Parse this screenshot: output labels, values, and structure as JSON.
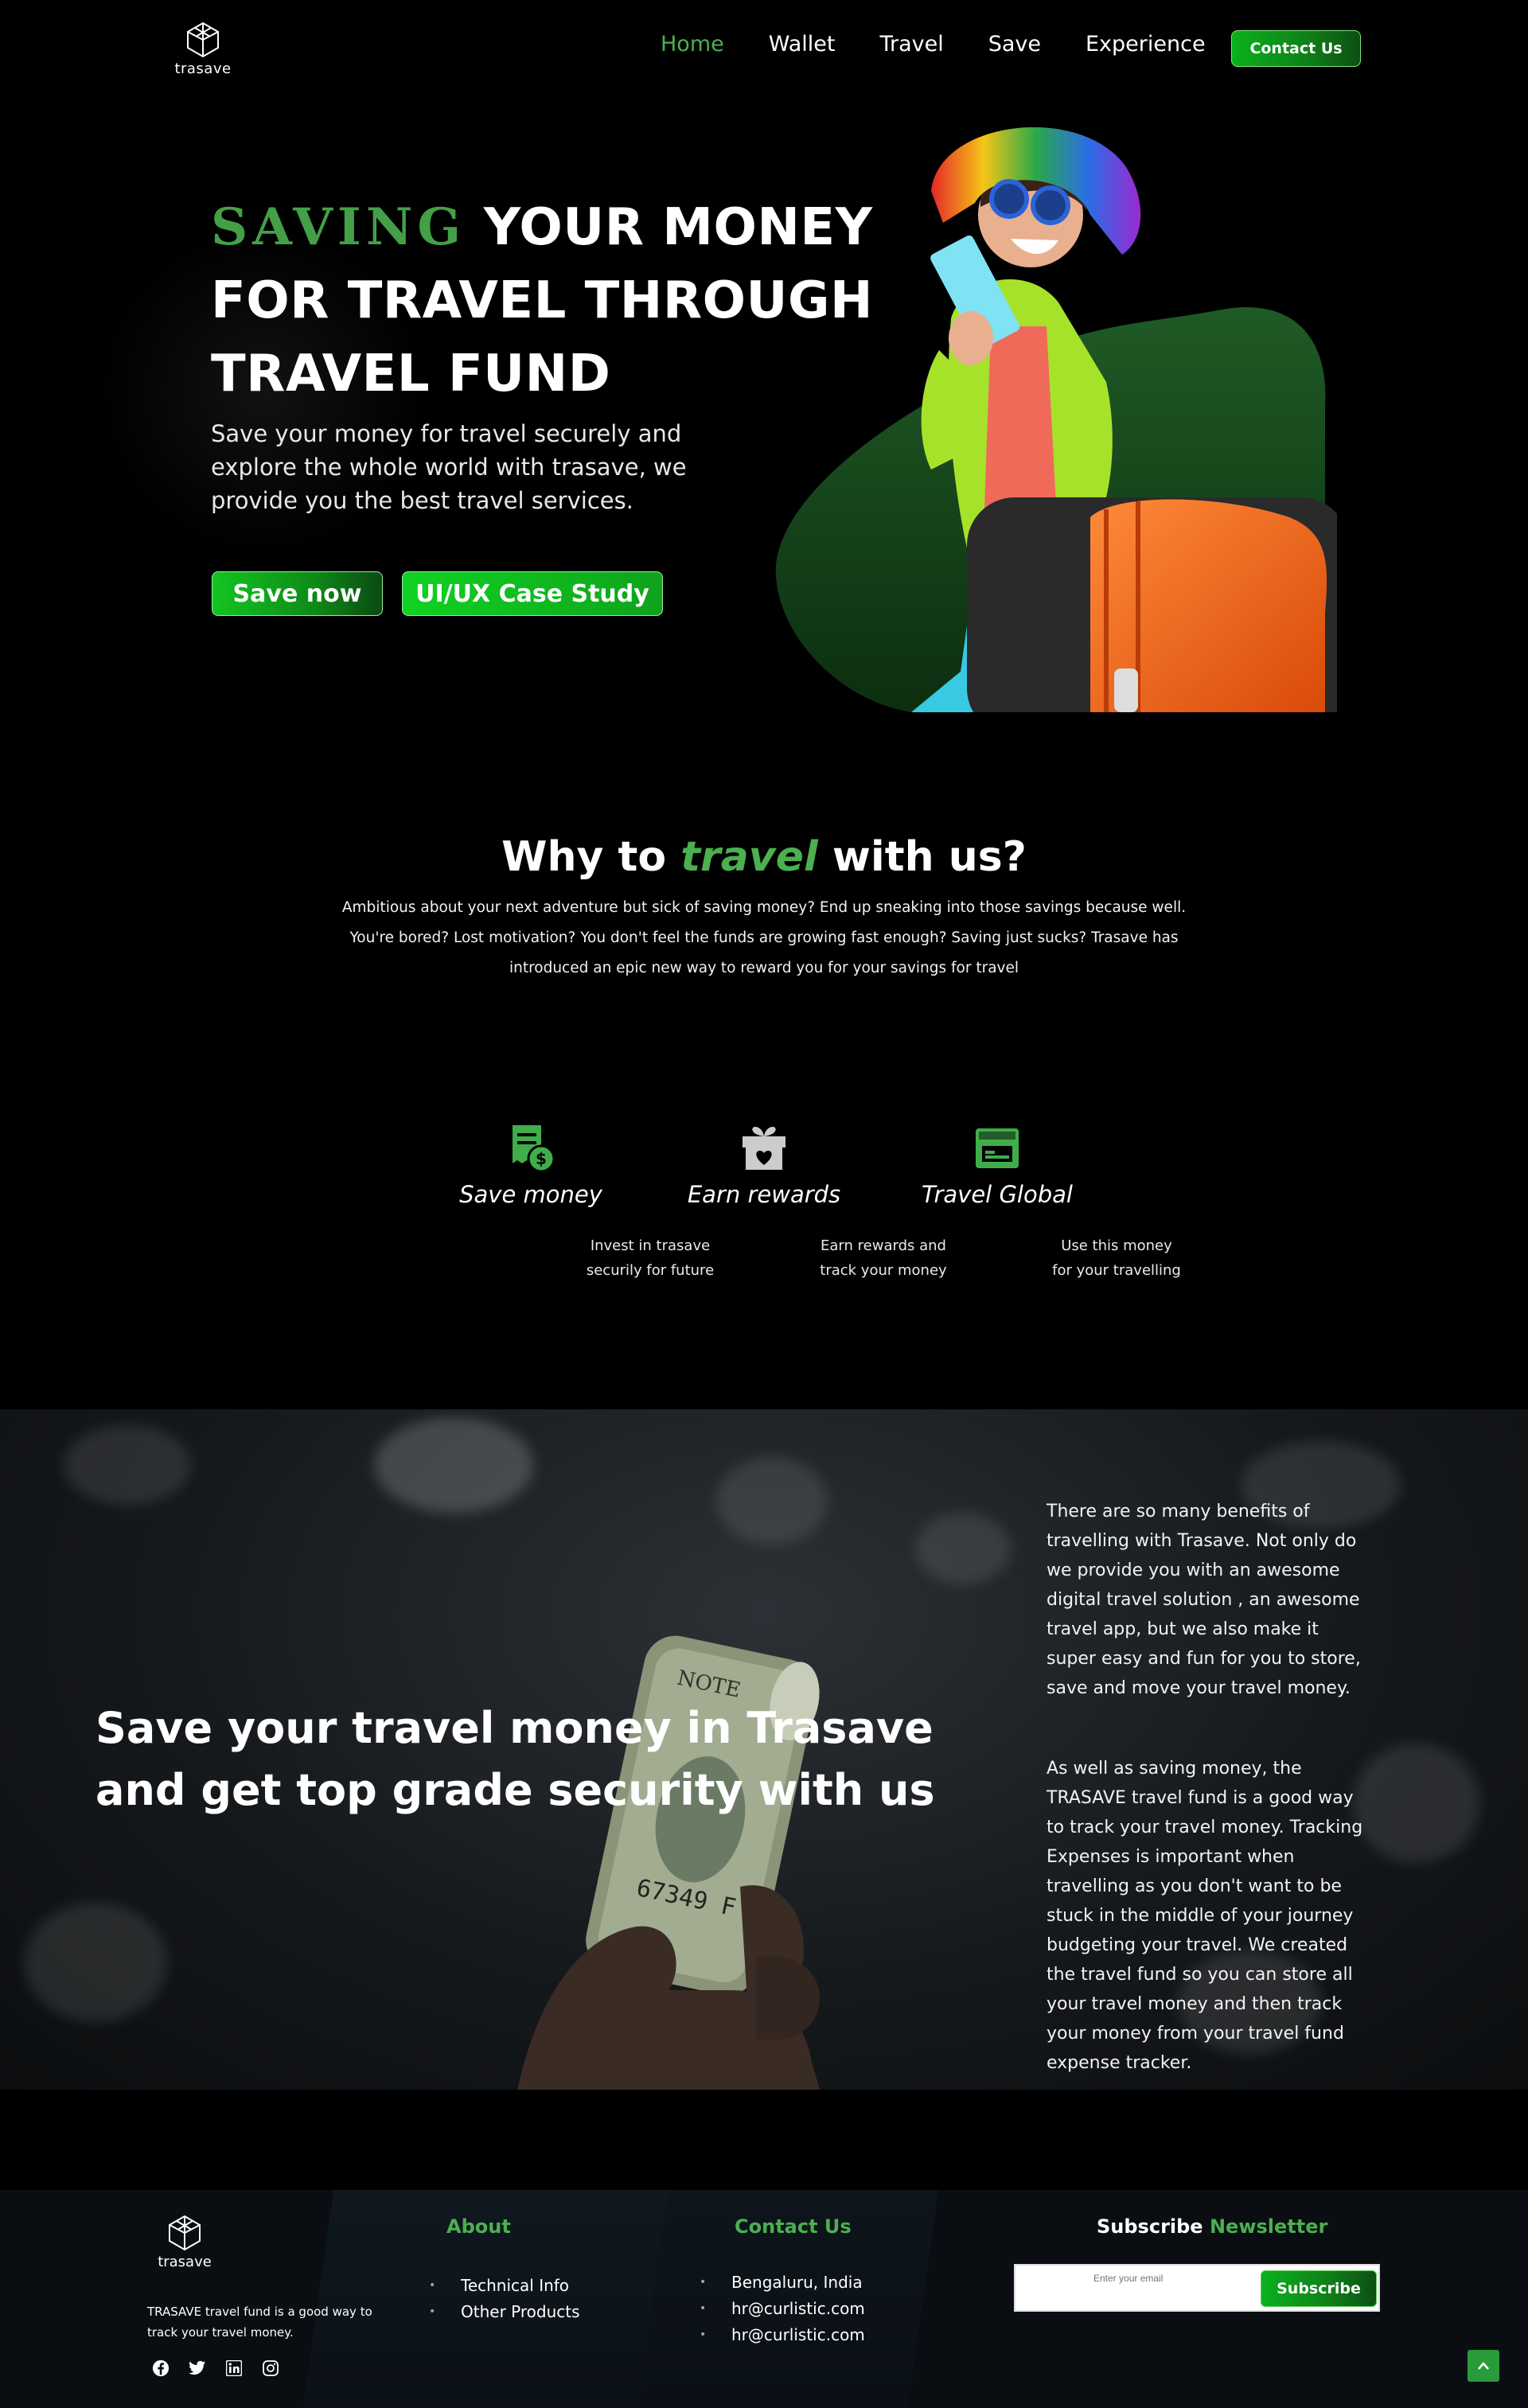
{
  "brand": {
    "name": "trasave"
  },
  "nav": {
    "items": [
      {
        "label": "Home",
        "active": true
      },
      {
        "label": "Wallet"
      },
      {
        "label": "Travel"
      },
      {
        "label": "Save"
      },
      {
        "label": "Experience"
      }
    ],
    "contact_label": "Contact Us"
  },
  "hero": {
    "title_accent": "SAVING",
    "title_rest": " YOUR MONEY FOR TRAVEL THROUGH TRAVEL FUND",
    "subtitle": "Save your money for travel securely and explore the whole world with trasave, we provide you the best travel services.",
    "btn_primary": "Save now",
    "btn_secondary": "UI/UX Case Study"
  },
  "why": {
    "title_before": "Why to ",
    "title_accent": "travel",
    "title_after": " with us?",
    "text": "Ambitious about your next adventure but sick of saving money? End up sneaking into those savings because well. You're bored? Lost motivation? You don't feel the funds are growing fast enough? Saving just sucks? Trasave has introduced an epic new way to reward you for your savings for travel"
  },
  "features": [
    {
      "icon": "receipt-dollar-icon",
      "title": "Save money",
      "desc": "Invest in trasave securily for future"
    },
    {
      "icon": "gift-heart-icon",
      "title": "Earn rewards",
      "desc": "Earn rewards and track your money"
    },
    {
      "icon": "store-icon",
      "title": "Travel Global",
      "desc": "Use this money for your travelling"
    }
  ],
  "security": {
    "title": "Save your travel money in Trasave and get top grade security with us",
    "p1": "There are so many benefits of travelling with Trasave. Not only do we provide you with an awesome digital travel solution , an awesome travel app, but we also make it super easy and fun for you to store, save and move your travel money.",
    "p2": "As well as saving money, the TRASAVE travel fund is a good way to track your travel money. Tracking Expenses is important when travelling as you don't want to be stuck in the middle of your journey budgeting your travel. We created the travel fund so you can store all your travel money and then track your money from your travel fund expense tracker."
  },
  "footer": {
    "description": "TRASAVE travel fund is a good way to track your travel money.",
    "about_heading": "About",
    "about_items": [
      "Technical Info",
      "Other Products"
    ],
    "contact_heading": "Contact Us",
    "contact_items": [
      "Bengaluru, India",
      "hr@curlistic.com",
      "hr@curlistic.com"
    ],
    "newsletter_heading_1": "Subscribe",
    "newsletter_heading_2": "Newsletter",
    "email_placeholder": "Enter your email",
    "subscribe_label": "Subscribe",
    "socials": [
      "facebook-icon",
      "twitter-icon",
      "linkedin-icon",
      "instagram-icon"
    ]
  },
  "colors": {
    "accent": "#4caf50",
    "button_green": "#0ab11e",
    "background": "#000000"
  }
}
